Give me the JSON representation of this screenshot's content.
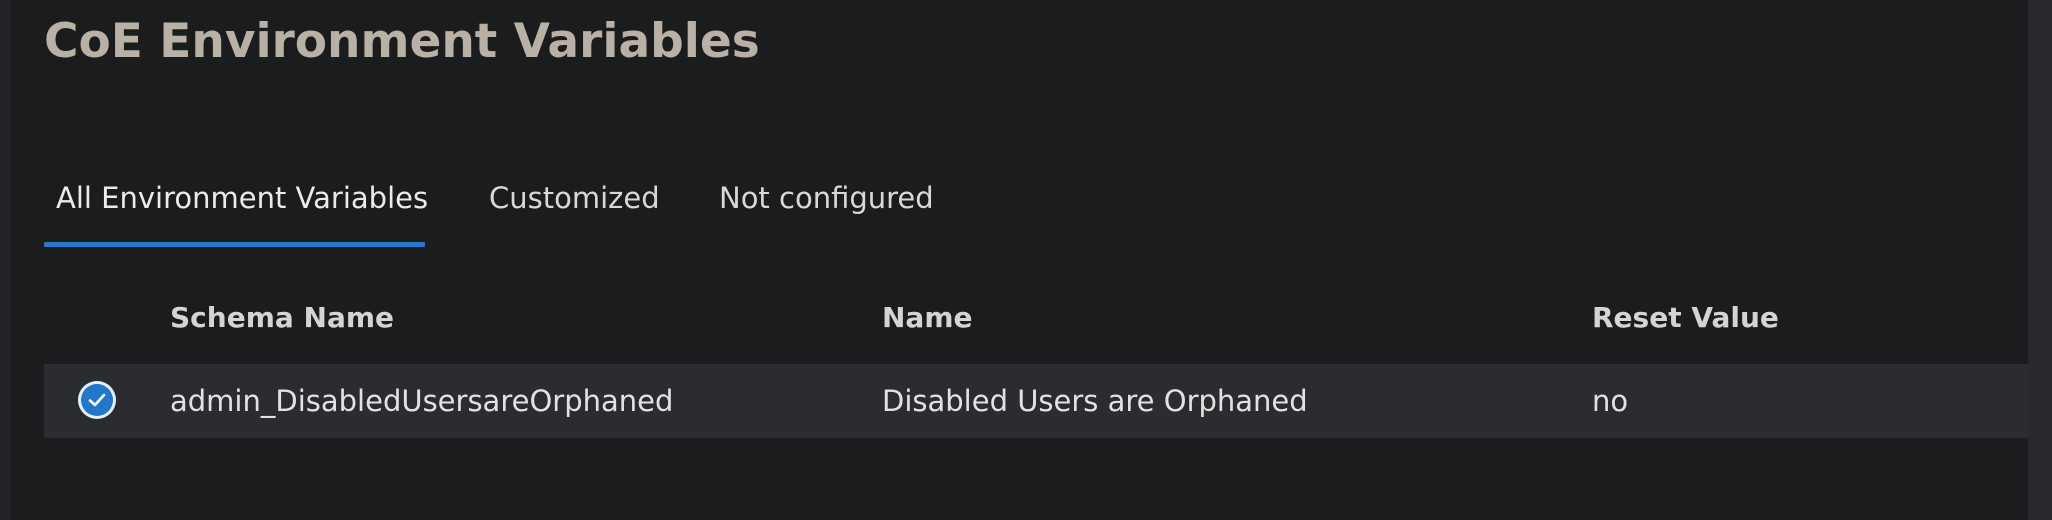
{
  "page": {
    "title": "CoE Environment Variables"
  },
  "tabs": [
    {
      "label": "All Environment Variables",
      "active": true
    },
    {
      "label": "Customized",
      "active": false
    },
    {
      "label": "Not configured",
      "active": false
    }
  ],
  "table": {
    "headers": [
      "Schema Name",
      "Name",
      "Reset Value"
    ],
    "rows": [
      {
        "selected": true,
        "schema_name": "admin_DisabledUsersareOrphaned",
        "name": "Disabled Users are Orphaned",
        "reset_value": "no"
      }
    ]
  },
  "colors": {
    "background": "#1b1c1e",
    "accent": "#2a78c8",
    "row_background": "#2b2c2f",
    "title": "#b9b0a6"
  },
  "icons": {
    "row_selection": "checkmark-circle-icon"
  }
}
